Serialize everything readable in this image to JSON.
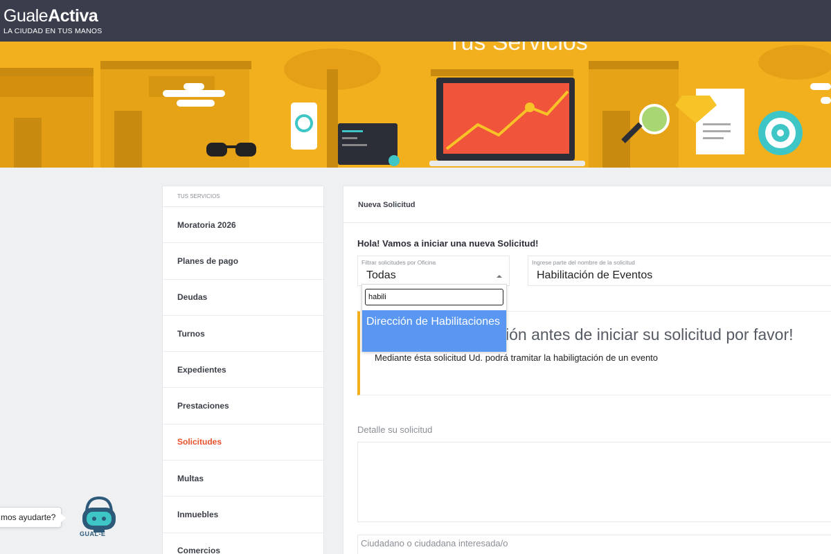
{
  "brand": {
    "name_light": "Guale",
    "name_bold": "Activa",
    "tagline": "LA CIUDAD EN TUS MANOS"
  },
  "banner": {
    "title": "Tus Servicios"
  },
  "sidebar": {
    "header": "TUS SERVICIOS",
    "items": [
      {
        "label": "Moratoria 2026"
      },
      {
        "label": "Planes de pago"
      },
      {
        "label": "Deudas"
      },
      {
        "label": "Turnos"
      },
      {
        "label": "Expedientes"
      },
      {
        "label": "Prestaciones"
      },
      {
        "label": "Solicitudes",
        "active": true
      },
      {
        "label": "Multas"
      },
      {
        "label": "Inmuebles"
      },
      {
        "label": "Comercios"
      }
    ]
  },
  "panel": {
    "title": "Nueva Solicitud",
    "greeting": "Hola! Vamos a iniciar una nueva Solicitud!",
    "filter_office": {
      "label": "Filtrar solicitudes por Oficina",
      "value": "Todas"
    },
    "filter_name": {
      "label": "Ingrese parte del nombre de la solicitud",
      "value": "Habilitación de Eventos"
    },
    "dropdown": {
      "search_value": "habili",
      "option": "Dirección de Habilitaciones"
    },
    "info": {
      "title": "ión antes de iniciar su solicitud por favor!",
      "body": "Mediante ésta solicitud Ud. podrá tramitar la habiligtación de un evento"
    },
    "detalle_label": "Detalle su solicitud",
    "ciudadano_placeholder": "Ciudadano o ciudadana interesada/o"
  },
  "help": {
    "bubble": "mos ayudarte?",
    "bot_name": "GUAL-E"
  },
  "colors": {
    "topbar": "#3a3d4c",
    "banner": "#f2b01e",
    "active": "#e8502a",
    "highlight": "#5a97f2"
  }
}
